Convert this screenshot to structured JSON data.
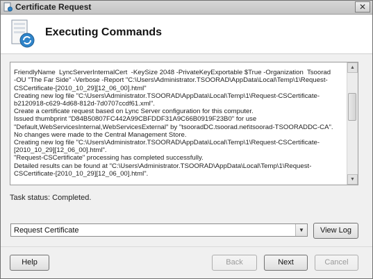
{
  "window": {
    "title": "Certificate Request",
    "close_label": "✕",
    "header_title": "Executing Commands"
  },
  "log": {
    "lines": [
      "FriendlyName  LyncServerInternalCert  -KeySize 2048 -PrivateKeyExportable $True -Organization  Tsoorad",
      "-OU \"The Far Side\" -Verbose -Report \"C:\\Users\\Administrator.TSOORAD\\AppData\\Local\\Temp\\1\\Request-",
      "CSCertificate-[2010_10_29][12_06_00].html\"",
      "Creating new log file \"C:\\Users\\Administrator.TSOORAD\\AppData\\Local\\Temp\\1\\Request-CSCertificate-",
      "b2120918-c629-4d68-812d-7d0707ccdf61.xml\".",
      "Create a certificate request based on Lync Server configuration for this computer.",
      "Issued thumbprint \"D84B50807FC442A99CBFDDF31A9C66B0919F23B0\" for use",
      "\"Default,WebServicesInternal,WebServicesExternal\" by \"tsooradDC.tsoorad.net\\tsoorad-TSOORADDC-CA\".",
      "No changes were made to the Central Management Store.",
      "Creating new log file \"C:\\Users\\Administrator.TSOORAD\\AppData\\Local\\Temp\\1\\Request-CSCertificate-",
      "[2010_10_29][12_06_00].html\".",
      "\"Request-CSCertificate\" processing has completed successfully.",
      "Detailed results can be found at \"C:\\Users\\Administrator.TSOORAD\\AppData\\Local\\Temp\\1\\Request-",
      "CSCertificate-[2010_10_29][12_06_00].html\"."
    ]
  },
  "status": {
    "text": "Task status: Completed."
  },
  "dropdown": {
    "selected": "Request Certificate"
  },
  "buttons": {
    "view_log": "View Log",
    "help": "Help",
    "back": "Back",
    "next": "Next",
    "cancel": "Cancel"
  },
  "colors": {
    "chrome": "#f0f0f0",
    "header_bg": "#ffffff",
    "disabled_text": "#9a9a9a"
  }
}
